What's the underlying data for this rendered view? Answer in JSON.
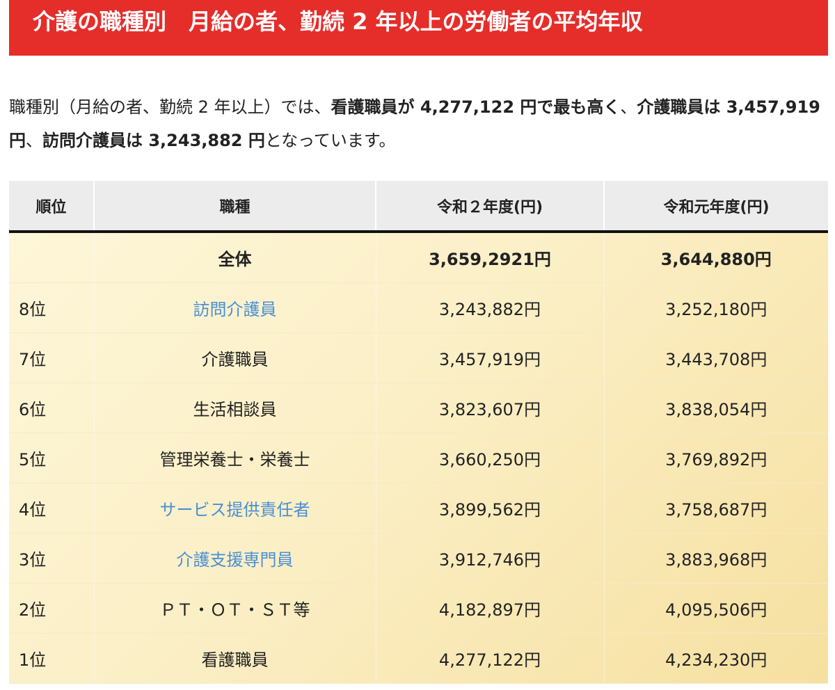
{
  "title": "介護の職種別　月給の者、勤続 2 年以上の労働者の平均年収",
  "intro": {
    "p1": "職種別（月給の者、勤続 2 年以上）では、",
    "b1": "看護職員が 4,277,122 円で最も高く",
    "p2": "、",
    "b2": "介護職員は 3,457,919 円",
    "p3": "、",
    "b3": "訪問介護員は 3,243,882 円",
    "p4": "となっています。"
  },
  "table": {
    "headers": {
      "rank": "順位",
      "job": "職種",
      "r2": "令和２年度(円)",
      "r1": "令和元年度(円)"
    },
    "total": {
      "rank": "",
      "job": "全体",
      "r2": "3,659,2921円",
      "r1": "3,644,880円"
    },
    "rows": [
      {
        "rank": "8位",
        "job": "訪問介護員",
        "r2": "3,243,882円",
        "r1": "3,252,180円"
      },
      {
        "rank": "7位",
        "job": "介護職員",
        "r2": "3,457,919円",
        "r1": "3,443,708円"
      },
      {
        "rank": "6位",
        "job": "生活相談員",
        "r2": "3,823,607円",
        "r1": "3,838,054円"
      },
      {
        "rank": "5位",
        "job": "管理栄養士・栄養士",
        "r2": "3,660,250円",
        "r1": "3,769,892円"
      },
      {
        "rank": "4位",
        "job": "サービス提供責任者",
        "r2": "3,899,562円",
        "r1": "3,758,687円"
      },
      {
        "rank": "3位",
        "job": "介護支援専門員",
        "r2": "3,912,746円",
        "r1": "3,883,968円"
      },
      {
        "rank": "2位",
        "job": "ＰＴ・ＯＴ・ＳＴ等",
        "r2": "4,182,897円",
        "r1": "4,095,506円"
      },
      {
        "rank": "1位",
        "job": "看護職員",
        "r2": "4,277,122円",
        "r1": "4,234,230円"
      }
    ]
  },
  "colors": {
    "title_bg": "#e52d2a",
    "link": "#4a8fd4",
    "header_bg": "#ececec",
    "body_gold": "#f6e0a0"
  }
}
